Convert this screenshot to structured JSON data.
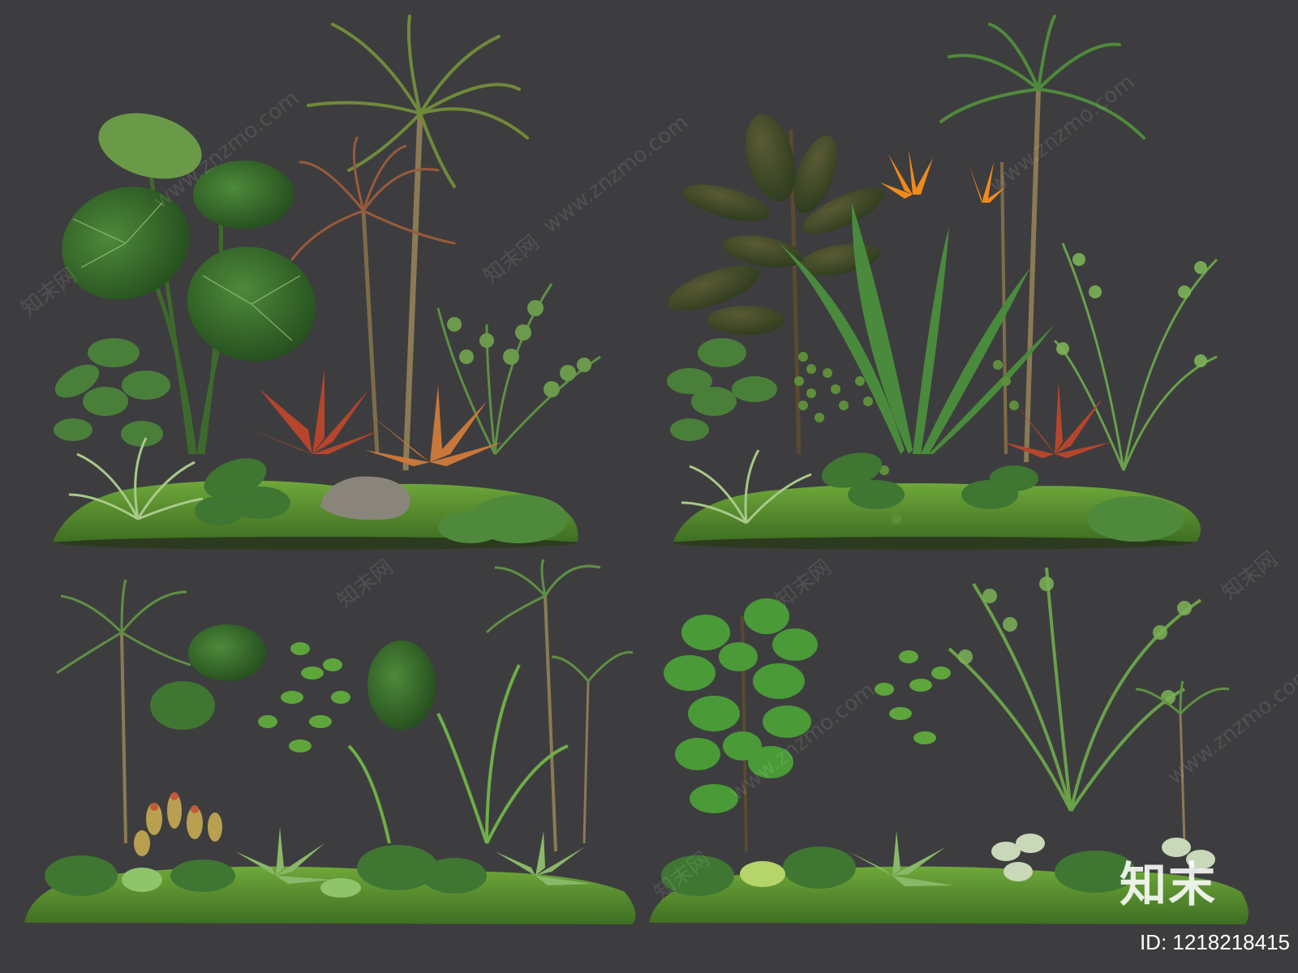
{
  "image": {
    "background_color": "#3d3d3f",
    "subject": "four tropical planting arrangement cut-outs in a 2x2 grid",
    "panels": [
      {
        "name": "top-left",
        "plants": [
          "monstera",
          "dracaena",
          "bromeliad",
          "fern",
          "moss",
          "rock"
        ]
      },
      {
        "name": "top-right",
        "plants": [
          "rubber-plant",
          "bird-of-paradise",
          "palm",
          "bromeliad",
          "string-of-pearls",
          "moss"
        ]
      },
      {
        "name": "bottom-left",
        "plants": [
          "dracaena",
          "monstera",
          "fern",
          "pitcher-plant",
          "bromeliad",
          "moss"
        ]
      },
      {
        "name": "bottom-right",
        "plants": [
          "fiddle-leaf-fig",
          "areca-palm",
          "fittonia",
          "bromeliad",
          "fern",
          "moss"
        ]
      }
    ]
  },
  "watermark": {
    "site_text": "www.znzmo.com",
    "brand_text": "知末网"
  },
  "logo": {
    "text": "知末"
  },
  "id_label": {
    "text": "ID: 1218218415"
  },
  "colors": {
    "dark_leaf": "#2f5d2a",
    "mid_leaf": "#4f8a3c",
    "light_leaf": "#8fc46a",
    "moss": "#5d8f2e",
    "bromeliad_red": "#b5452c",
    "bromeliad_orange": "#c9773a",
    "flower_orange": "#f08a1c",
    "trunk": "#8a7a55",
    "rock": "#8a857a"
  }
}
